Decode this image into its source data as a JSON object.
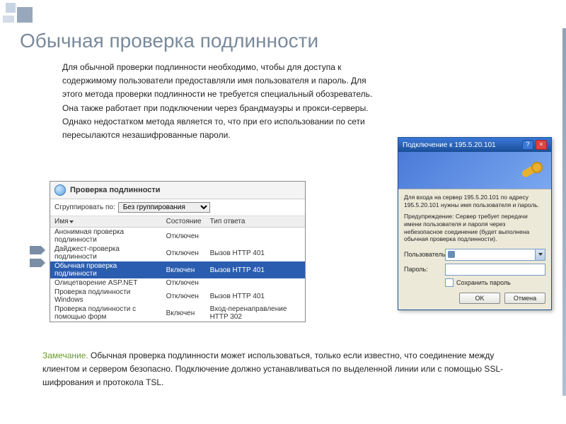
{
  "slide": {
    "title": "Обычная проверка подлинности",
    "paragraph": "Для обычной проверки подлинности необходимо, чтобы для доступа к содержимому пользователи предоставляли имя пользователя и пароль. Для этого метода проверки подлинности не требуется специальный обозреватель. Она также работает при подключении через брандмауэры и прокси-серверы. Однако недостатком метода является то, что при его использовании по сети пересылаются незашифрованные пароли.",
    "note_label": "Замечание.",
    "note_body": " Обычная проверка подлинности может использоваться, только если известно, что соединение между клиентом и сервером безопасно. Подключение должно устанавливаться по выделенной линии или с помощью SSL-шифрования и протокола TSL."
  },
  "config": {
    "title": "Проверка подлинности",
    "group_label": "Сгруппировать по:",
    "group_value": "Без группирования",
    "cols": {
      "name": "Имя",
      "state": "Состояние",
      "resp": "Тип ответа"
    },
    "rows": [
      {
        "name": "Анонимная проверка подлинности",
        "state": "Отключен",
        "resp": ""
      },
      {
        "name": "Дайджест-проверка подлинности",
        "state": "Отключен",
        "resp": "Вызов HTTP 401"
      },
      {
        "name": "Обычная проверка подлинности",
        "state": "Включен",
        "resp": "Вызов HTTP 401"
      },
      {
        "name": "Олицетворение ASP.NET",
        "state": "Отключен",
        "resp": ""
      },
      {
        "name": "Проверка подлинности Windows",
        "state": "Отключен",
        "resp": "Вызов HTTP 401"
      },
      {
        "name": "Проверка подлинности с помощью форм",
        "state": "Включен",
        "resp": "Вход-перенаправление HTTP 302"
      }
    ],
    "selected_index": 2
  },
  "dialog": {
    "title": "Подключение к 195.5.20.101",
    "info": "Для входа на сервер 195.5.20.101 по адресу 195.5.20.101 нужны имя пользователя и пароль.",
    "warn": "Предупреждение: Сервер требует передачи имени пользователя и пароля через небезопасное соединение (будет выполнена обычная проверка подлинности).",
    "user_label": "Пользователь:",
    "user_value": "",
    "pass_label": "Пароль:",
    "pass_value": "",
    "save_label": "Сохранить пароль",
    "ok": "OK",
    "cancel": "Отмена"
  }
}
